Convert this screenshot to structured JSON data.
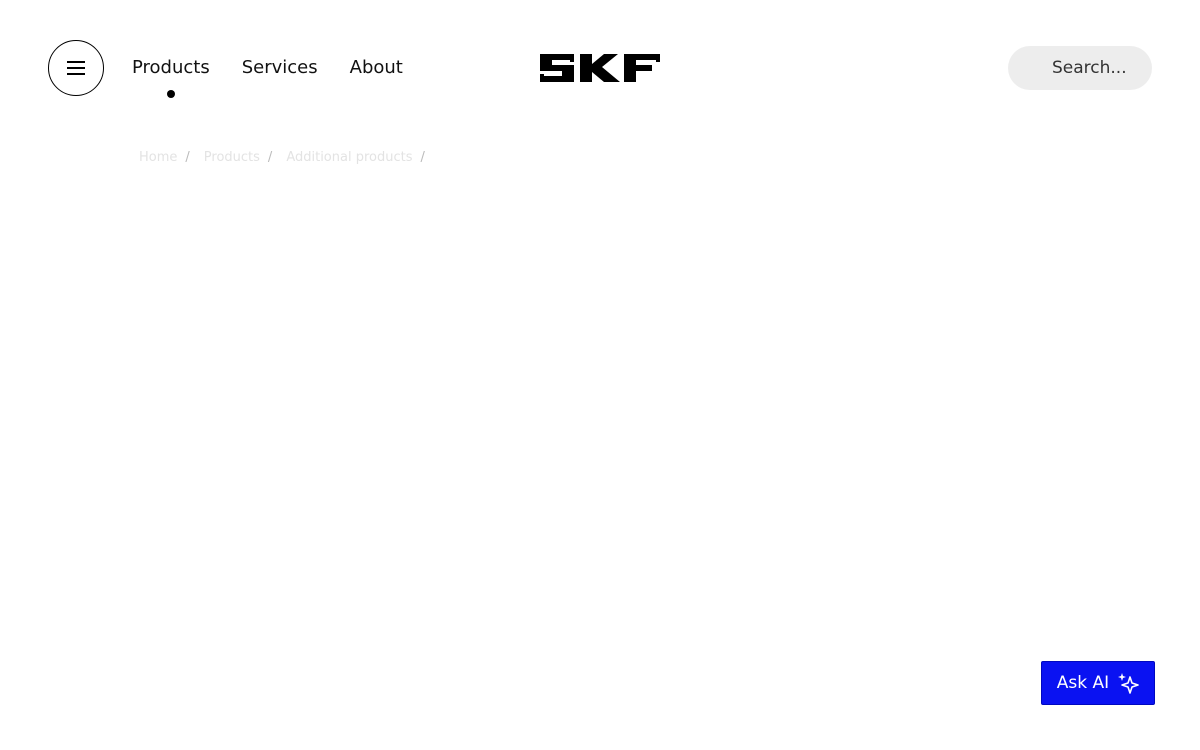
{
  "header": {
    "menu_icon": "hamburger-icon",
    "nav": [
      {
        "label": "Products",
        "active": true
      },
      {
        "label": "Services",
        "active": false
      },
      {
        "label": "About",
        "active": false
      }
    ],
    "logo_text": "SKF",
    "search": {
      "placeholder": "Search..."
    }
  },
  "breadcrumb": {
    "items": [
      "Home",
      "Products",
      "Additional products"
    ],
    "separator": "/"
  },
  "ask_ai": {
    "label": "Ask AI",
    "icon": "sparkle-icon"
  },
  "colors": {
    "accent": "#0a12f2",
    "search_bg": "#ededed"
  }
}
